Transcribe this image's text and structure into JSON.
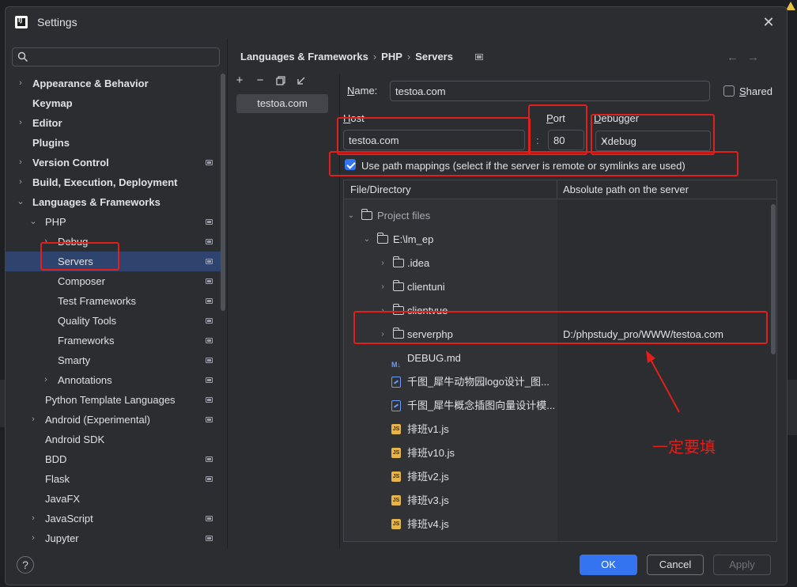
{
  "window": {
    "title": "Settings",
    "app_icon": "IJ"
  },
  "search": {
    "placeholder": "",
    "value": ""
  },
  "tree": [
    {
      "label": "Appearance & Behavior",
      "bold": true,
      "arrow": "›",
      "level": 0,
      "has_proj_icon": false
    },
    {
      "label": "Keymap",
      "bold": true,
      "arrow": "",
      "level": 0,
      "has_proj_icon": false
    },
    {
      "label": "Editor",
      "bold": true,
      "arrow": "›",
      "level": 0,
      "has_proj_icon": false
    },
    {
      "label": "Plugins",
      "bold": true,
      "arrow": "",
      "level": 0,
      "has_proj_icon": false
    },
    {
      "label": "Version Control",
      "bold": true,
      "arrow": "›",
      "level": 0,
      "has_proj_icon": true
    },
    {
      "label": "Build, Execution, Deployment",
      "bold": true,
      "arrow": "›",
      "level": 0,
      "has_proj_icon": false
    },
    {
      "label": "Languages & Frameworks",
      "bold": true,
      "arrow": "⌄",
      "level": 0,
      "has_proj_icon": false
    },
    {
      "label": "PHP",
      "bold": false,
      "arrow": "⌄",
      "level": 1,
      "has_proj_icon": true
    },
    {
      "label": "Debug",
      "bold": false,
      "arrow": "›",
      "level": 2,
      "has_proj_icon": true
    },
    {
      "label": "Servers",
      "bold": false,
      "arrow": "",
      "level": 2,
      "has_proj_icon": true,
      "selected": true
    },
    {
      "label": "Composer",
      "bold": false,
      "arrow": "",
      "level": 2,
      "has_proj_icon": true
    },
    {
      "label": "Test Frameworks",
      "bold": false,
      "arrow": "",
      "level": 2,
      "has_proj_icon": true
    },
    {
      "label": "Quality Tools",
      "bold": false,
      "arrow": "",
      "level": 2,
      "has_proj_icon": true
    },
    {
      "label": "Frameworks",
      "bold": false,
      "arrow": "",
      "level": 2,
      "has_proj_icon": true
    },
    {
      "label": "Smarty",
      "bold": false,
      "arrow": "",
      "level": 2,
      "has_proj_icon": true
    },
    {
      "label": "Annotations",
      "bold": false,
      "arrow": "›",
      "level": 2,
      "has_proj_icon": true
    },
    {
      "label": "Python Template Languages",
      "bold": false,
      "arrow": "",
      "level": 1,
      "has_proj_icon": true
    },
    {
      "label": "Android (Experimental)",
      "bold": false,
      "arrow": "›",
      "level": 1,
      "has_proj_icon": true
    },
    {
      "label": "Android SDK",
      "bold": false,
      "arrow": "",
      "level": 1,
      "has_proj_icon": false
    },
    {
      "label": "BDD",
      "bold": false,
      "arrow": "",
      "level": 1,
      "has_proj_icon": true
    },
    {
      "label": "Flask",
      "bold": false,
      "arrow": "",
      "level": 1,
      "has_proj_icon": true
    },
    {
      "label": "JavaFX",
      "bold": false,
      "arrow": "",
      "level": 1,
      "has_proj_icon": false
    },
    {
      "label": "JavaScript",
      "bold": false,
      "arrow": "›",
      "level": 1,
      "has_proj_icon": true
    },
    {
      "label": "Jupyter",
      "bold": false,
      "arrow": "›",
      "level": 1,
      "has_proj_icon": true
    }
  ],
  "breadcrumb": [
    "Languages & Frameworks",
    "PHP",
    "Servers"
  ],
  "server_list": {
    "items": [
      "testoa.com"
    ]
  },
  "form": {
    "name_label": "Name:",
    "name_value": "testoa.com",
    "shared_label": "Shared",
    "shared_checked": false,
    "host_label": "Host",
    "host_value": "testoa.com",
    "colon": ":",
    "port_label": "Port",
    "port_value": "80",
    "debugger_label": "Debugger",
    "debugger_value": "Xdebug",
    "path_mappings_label": "Use path mappings (select if the server is remote or symlinks are used)",
    "path_mappings_checked": true
  },
  "mappings": {
    "col_file": "File/Directory",
    "col_path": "Absolute path on the server",
    "rows": [
      {
        "name": "Project files",
        "type": "folder",
        "chev": "⌄",
        "depth": 0,
        "path": "",
        "dim": true
      },
      {
        "name": "E:\\lm_ep",
        "type": "folder",
        "chev": "⌄",
        "depth": 1,
        "path": ""
      },
      {
        "name": ".idea",
        "type": "folder",
        "chev": "›",
        "depth": 2,
        "path": ""
      },
      {
        "name": "clientuni",
        "type": "folder",
        "chev": "›",
        "depth": 2,
        "path": ""
      },
      {
        "name": "clientvue",
        "type": "folder",
        "chev": "›",
        "depth": 2,
        "path": ""
      },
      {
        "name": "serverphp",
        "type": "folder",
        "chev": "›",
        "depth": 2,
        "path": "D:/phpstudy_pro/WWW/testoa.com"
      },
      {
        "name": "DEBUG.md",
        "type": "md",
        "chev": "",
        "depth": 2,
        "path": ""
      },
      {
        "name": "千图_犀牛动物园logo设计_图...",
        "type": "img",
        "chev": "",
        "depth": 2,
        "path": ""
      },
      {
        "name": "千图_犀牛概念插图向量设计模...",
        "type": "img",
        "chev": "",
        "depth": 2,
        "path": ""
      },
      {
        "name": "排班v1.js",
        "type": "js",
        "chev": "",
        "depth": 2,
        "path": ""
      },
      {
        "name": "排班v10.js",
        "type": "js",
        "chev": "",
        "depth": 2,
        "path": ""
      },
      {
        "name": "排班v2.js",
        "type": "js",
        "chev": "",
        "depth": 2,
        "path": ""
      },
      {
        "name": "排班v3.js",
        "type": "js",
        "chev": "",
        "depth": 2,
        "path": ""
      },
      {
        "name": "排班v4.js",
        "type": "js",
        "chev": "",
        "depth": 2,
        "path": ""
      }
    ]
  },
  "annotation_text": "一定要填",
  "buttons": {
    "ok": "OK",
    "cancel": "Cancel",
    "apply": "Apply",
    "help": "?"
  },
  "colors": {
    "accent": "#3574f0",
    "annotation": "#e0201b",
    "selection": "#2e436e"
  }
}
